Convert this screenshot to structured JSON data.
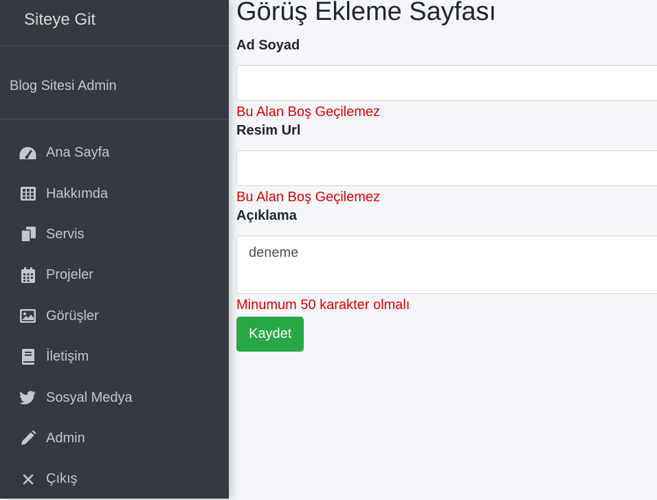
{
  "sidebar": {
    "brand": "Siteye Git",
    "panel_title": "Blog Sitesi Admin",
    "items": [
      {
        "label": "Ana Sayfa",
        "icon": "tachometer-icon"
      },
      {
        "label": "Hakkımda",
        "icon": "table-grid-icon"
      },
      {
        "label": "Servis",
        "icon": "copy-icon"
      },
      {
        "label": "Projeler",
        "icon": "calendar-icon"
      },
      {
        "label": "Görüşler",
        "icon": "image-icon"
      },
      {
        "label": "İletişim",
        "icon": "book-icon"
      },
      {
        "label": "Sosyal Medya",
        "icon": "twitter-icon"
      },
      {
        "label": "Admin",
        "icon": "pencil-icon"
      },
      {
        "label": "Çıkış",
        "icon": "close-icon"
      }
    ]
  },
  "main": {
    "title": "Görüş Ekleme Sayfası",
    "fields": {
      "name": {
        "label": "Ad Soyad",
        "value": "",
        "error": "Bu Alan Boş Geçilemez"
      },
      "image_url": {
        "label": "Resim Url",
        "value": "",
        "error": "Bu Alan Boş Geçilemez"
      },
      "description": {
        "label": "Açıklama",
        "value": "deneme",
        "error": "Minumum 50 karakter olmalı"
      }
    },
    "save_label": "Kaydet"
  },
  "colors": {
    "sidebar_bg": "#343a40",
    "error": "#e00000",
    "save_button": "#28a745"
  }
}
